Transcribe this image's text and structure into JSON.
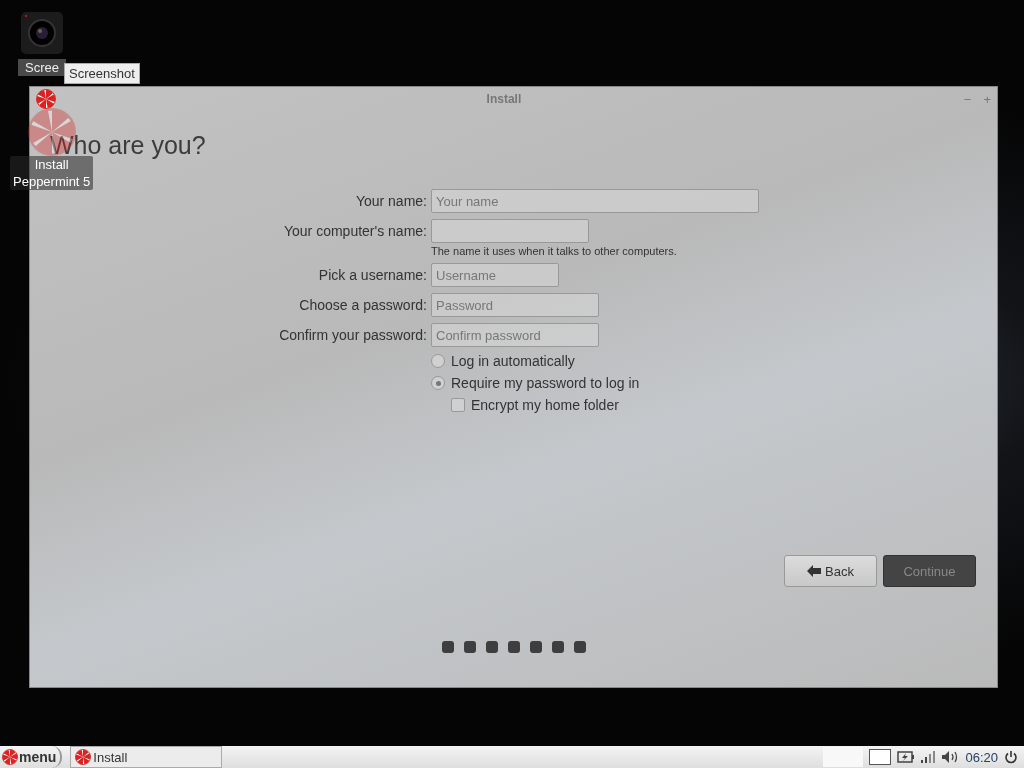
{
  "desktop_icons": [
    {
      "kind": "camera",
      "label": "Scree"
    },
    {
      "kind": "candy",
      "label": "Install\nPeppermint 5"
    }
  ],
  "tooltip": "Screenshot",
  "window": {
    "title": "Install",
    "controls": [
      "−",
      "+"
    ],
    "heading": "Who are you?",
    "fields": [
      {
        "label": "Your name:",
        "placeholder": "Your name"
      },
      {
        "label": "Your computer's name:",
        "hint": "The name it uses when it talks to other computers."
      },
      {
        "label": "Pick a username:",
        "placeholder": "Username"
      },
      {
        "label": "Choose a password:",
        "placeholder": "Password"
      },
      {
        "label": "Confirm your password:",
        "placeholder": "Confirm password"
      }
    ],
    "options": [
      {
        "kind": "radio",
        "label": "Log in automatically",
        "selected": false
      },
      {
        "kind": "radio",
        "label": "Require my password to log in",
        "selected": true
      },
      {
        "kind": "checkbox",
        "label": "Encrypt my home folder",
        "checked": false
      }
    ],
    "buttons": [
      {
        "kind": "back",
        "label": "Back",
        "disabled": false
      },
      {
        "kind": "continue",
        "label": "Continue",
        "disabled": true
      }
    ],
    "steps": [
      {
        "selected": false
      },
      {
        "selected": false
      },
      {
        "selected": false
      },
      {
        "selected": false
      },
      {
        "selected": false
      },
      {
        "selected": false
      },
      {
        "selected": false
      }
    ]
  },
  "taskbar": {
    "menu": "menu",
    "tasks": [
      "Install"
    ],
    "clock": "06:20"
  }
}
